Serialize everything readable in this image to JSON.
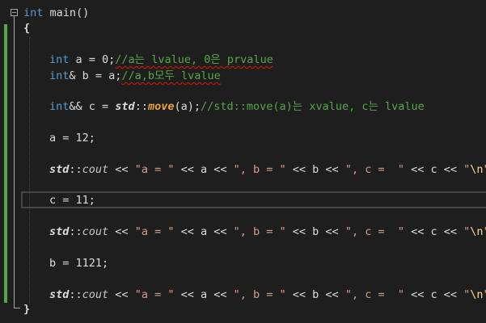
{
  "editor": {
    "lines": {
      "l1": {
        "kw": "int",
        "name": " main()"
      },
      "l2": {
        "brace": "{"
      },
      "l3": {
        "kw": "int",
        "rest": " a = 0;",
        "comment": "//a는 lvalue, 0은 prvalue"
      },
      "l4": {
        "kw": "int",
        "rest": "& b = a;",
        "comment": "//a,b모두 lvalue"
      },
      "l5": {
        "kw": "int",
        "rest": "&& c = ",
        "ns": "std",
        "sep": "::",
        "fn": "move",
        "args": "(a);",
        "comment": "//std::move(a)는 xvalue, c는 lvalue"
      },
      "l6": {
        "text": "a = 12;"
      },
      "l7": {
        "ns": "std",
        "sep": "::",
        "cout": "cout",
        "s1": " << ",
        "str1": "\"a = \"",
        "s2": " << a << ",
        "str2": "\", b = \"",
        "s3": " << b << ",
        "str3": "\", c =  \"",
        "s4": " << c << ",
        "str4": "\"",
        "esc": "\\n",
        "str5": "\";"
      },
      "l8": {
        "text": "c = 11;"
      },
      "l9": {
        "ns": "std",
        "sep": "::",
        "cout": "cout",
        "s1": " << ",
        "str1": "\"a = \"",
        "s2": " << a << ",
        "str2": "\", b = \"",
        "s3": " << b << ",
        "str3": "\", c =  \"",
        "s4": " << c << ",
        "str4": "\"",
        "esc": "\\n",
        "str5": "\";"
      },
      "l10": {
        "text": "b = 1121;"
      },
      "l11": {
        "ns": "std",
        "sep": "::",
        "cout": "cout",
        "s1": " << ",
        "str1": "\"a = \"",
        "s2": " << a << ",
        "str2": "\", b = \"",
        "s3": " << b << ",
        "str3": "\", c =  \"",
        "s4": " << c << ",
        "str4": "\"",
        "esc": "\\n",
        "str5": "\";"
      },
      "l12": {
        "brace": "}"
      }
    },
    "colors": {
      "background": "#1e1e1e",
      "keyword": "#569cd6",
      "comment": "#57a64a",
      "string": "#d69d85",
      "function": "#e8a33c",
      "change_bar": "#57a64a"
    }
  }
}
